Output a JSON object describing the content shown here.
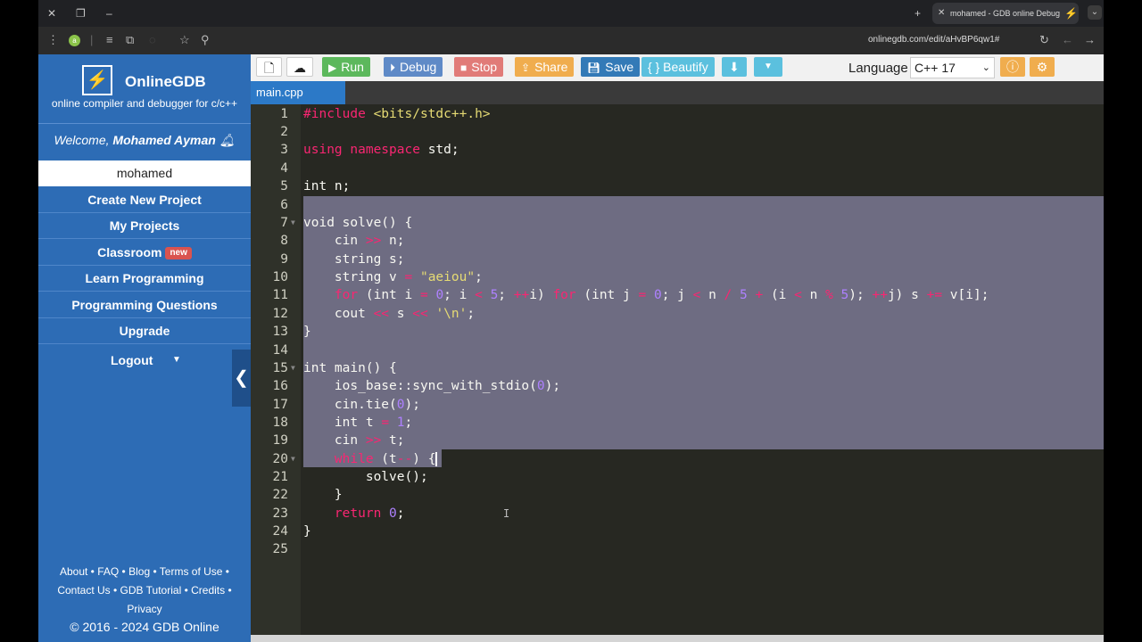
{
  "browser": {
    "tab_title": "mohamed - GDB online Debug",
    "url": "onlinegdb.com/edit/aHvBP6qw1#",
    "extension_badge": "a"
  },
  "sidebar": {
    "brand": "OnlineGDB",
    "tagline": "online compiler and debugger for c/c++",
    "welcome_prefix": "Welcome,",
    "welcome_user": "Mohamed Ayman",
    "user_box": "mohamed",
    "nav": [
      {
        "label": "Create New Project"
      },
      {
        "label": "My Projects"
      },
      {
        "label": "Classroom",
        "badge": "new"
      },
      {
        "label": "Learn Programming"
      },
      {
        "label": "Programming Questions"
      },
      {
        "label": "Upgrade"
      }
    ],
    "logout": "Logout",
    "footer_links": [
      "About",
      "FAQ",
      "Blog",
      "Terms of Use",
      "Contact Us",
      "GDB Tutorial",
      "Credits",
      "Privacy"
    ],
    "copyright": "© 2016 - 2024 GDB Online"
  },
  "toolbar": {
    "run": "Run",
    "debug": "Debug",
    "stop": "Stop",
    "share": "Share",
    "save": "Save",
    "beautify": "{ } Beautify",
    "language_label": "Language",
    "language_value": "C++ 17",
    "colors": {
      "run": "#5cb85c",
      "debug": "#5f8ac7",
      "stop": "#d9534f",
      "share": "#f0ad4e",
      "save": "#337ab7",
      "beautify": "#5bc0de"
    }
  },
  "file_tab": "main.cpp",
  "editor": {
    "line_numbers": [
      "1",
      "2",
      "3",
      "4",
      "5",
      "6",
      "7",
      "8",
      "9",
      "10",
      "11",
      "12",
      "13",
      "14",
      "15",
      "16",
      "17",
      "18",
      "19",
      "20",
      "21",
      "22",
      "23",
      "24",
      "25"
    ]
  }
}
